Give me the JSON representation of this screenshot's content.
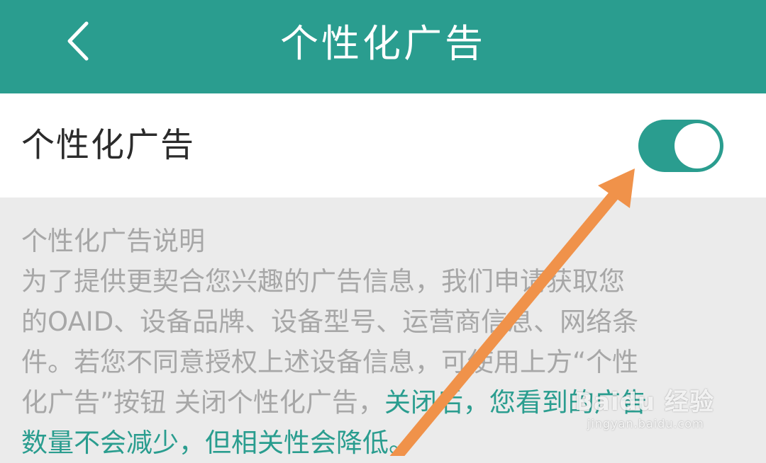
{
  "header": {
    "title": "个性化广告",
    "back_icon": "chevron-left-icon"
  },
  "colors": {
    "accent": "#2a9d8f",
    "annotation": "#f0924a",
    "description_text": "#a7a7a7",
    "background": "#ebebeb"
  },
  "setting": {
    "label": "个性化广告",
    "enabled": true
  },
  "description": {
    "title": "个性化广告说明",
    "lines": [
      "为了提供更契合您兴趣的广告信息，我们申请获取您",
      "的OAID、设备品牌、设备型号、运营商信息、网络条",
      "件。若您不同意授权上述设备信息，可使用上方“个性",
      "化广告”按钮 关闭个性化广告，"
    ],
    "highlight_inline": "关闭后，您看到的广告",
    "highlight_line": "数量不会减少，但相关性会降低。"
  },
  "watermark": {
    "logo": "Baidu 经验",
    "url": "jingyan.baidu.com"
  }
}
